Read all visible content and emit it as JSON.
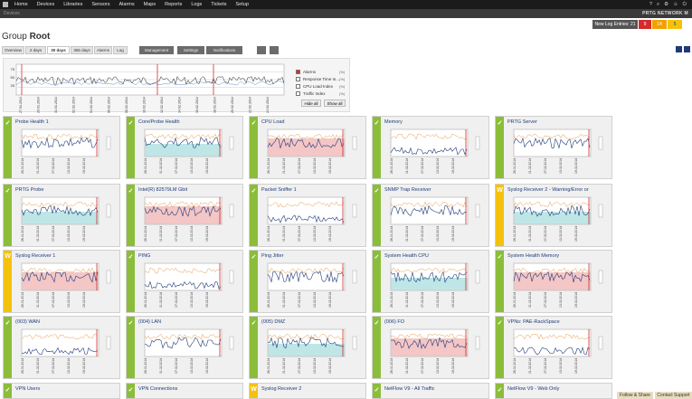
{
  "nav": {
    "items": [
      "Home",
      "Devices",
      "Libraries",
      "Sensors",
      "Alarms",
      "Maps",
      "Reports",
      "Logs",
      "Tickets",
      "Setup"
    ]
  },
  "breadcrumb": "Devices",
  "brand": "PRTG NETWORK M",
  "title": {
    "prefix": "Group",
    "name": "Root"
  },
  "logbar": {
    "label": "New Log Entries: 21",
    "b1": "9",
    "b2": "14",
    "b3": "5"
  },
  "tabs": [
    "Overview",
    "2 days",
    "30 days",
    "365 days",
    "Alarms",
    "Log"
  ],
  "toolbar": {
    "management": "Management",
    "settings": "Settings",
    "notifications": "Notifications"
  },
  "legend": [
    {
      "label": "Alarms",
      "pct": "(%)",
      "color": "#d52b2b"
    },
    {
      "label": "Response Time In...",
      "pct": "(%)",
      "color": "#ffffff"
    },
    {
      "label": "CPU Load Index",
      "pct": "(%)",
      "color": "#ffffff"
    },
    {
      "label": "Traffic Index",
      "pct": "(%)",
      "color": "#ffffff"
    }
  ],
  "legend_buttons": {
    "hide": "Hide all",
    "show": "Show all"
  },
  "overview_dates": [
    "27.01.2014",
    "29.01.2014",
    "31.01.2014",
    "02.02.2014",
    "04.02.2014",
    "06.02.2014",
    "08.02.2014",
    "10.02.2014",
    "12.02.2014",
    "14.02.2014",
    "16.02.2014",
    "18.02.2014",
    "20.02.2014",
    "22.02.2014",
    "24.02.2014"
  ],
  "overview_axis": [
    "75",
    "50",
    "25"
  ],
  "sensors": [
    {
      "name": "Probe Health 1",
      "status": "ok",
      "icon": "✓"
    },
    {
      "name": "Core/Probe Health",
      "status": "ok",
      "icon": "✓"
    },
    {
      "name": "CPU Load",
      "status": "ok",
      "icon": "✓"
    },
    {
      "name": "Memory",
      "status": "ok",
      "icon": "✓"
    },
    {
      "name": "PRTG Server",
      "status": "ok",
      "icon": "✓"
    },
    {
      "name": "PRTG Probe",
      "status": "ok",
      "icon": "✓"
    },
    {
      "name": "Intel(R) 82579LM Gbit",
      "status": "ok",
      "icon": "✓"
    },
    {
      "name": "Packet Sniffer 1",
      "status": "ok",
      "icon": "✓"
    },
    {
      "name": "SNMP Trap Receiver",
      "status": "ok",
      "icon": "✓"
    },
    {
      "name": "Syslog Receiver 2 - Warning/Error or",
      "status": "warn",
      "icon": "W"
    },
    {
      "name": "Syslog Receiver 1",
      "status": "warn",
      "icon": "W"
    },
    {
      "name": "PING",
      "status": "ok",
      "icon": "✓"
    },
    {
      "name": "Ping Jitter",
      "status": "ok",
      "icon": "✓"
    },
    {
      "name": "System Health CPU",
      "status": "ok",
      "icon": "✓"
    },
    {
      "name": "System Health Memory",
      "status": "ok",
      "icon": "✓"
    },
    {
      "name": "(003) WAN",
      "status": "ok",
      "icon": "✓"
    },
    {
      "name": "(004) LAN",
      "status": "ok",
      "icon": "✓"
    },
    {
      "name": "(005) DMZ",
      "status": "ok",
      "icon": "✓"
    },
    {
      "name": "(006) FO",
      "status": "ok",
      "icon": "✓"
    },
    {
      "name": "VPNs: PAE-RackSpace",
      "status": "ok",
      "icon": "✓"
    },
    {
      "name": "VPN Users",
      "status": "ok",
      "icon": "✓"
    },
    {
      "name": "VPN Connections",
      "status": "ok",
      "icon": "✓"
    },
    {
      "name": "Syslog Receiver 2",
      "status": "warn",
      "icon": "W"
    },
    {
      "name": "NetFlow V9 - All Traffic",
      "status": "ok",
      "icon": "✓"
    },
    {
      "name": "NetFlow V9 - Web Only",
      "status": "ok",
      "icon": "✓"
    }
  ],
  "tile_dates": [
    "26.01.2014",
    "29.01.2014",
    "01.02.2014",
    "04.02.2014",
    "07.02.2014",
    "10.02.2014",
    "13.02.2014",
    "16.02.2014",
    "19.02.2014",
    "22.02.2014"
  ],
  "footer": {
    "follow": "Follow & Share",
    "support": "Contact Support"
  }
}
